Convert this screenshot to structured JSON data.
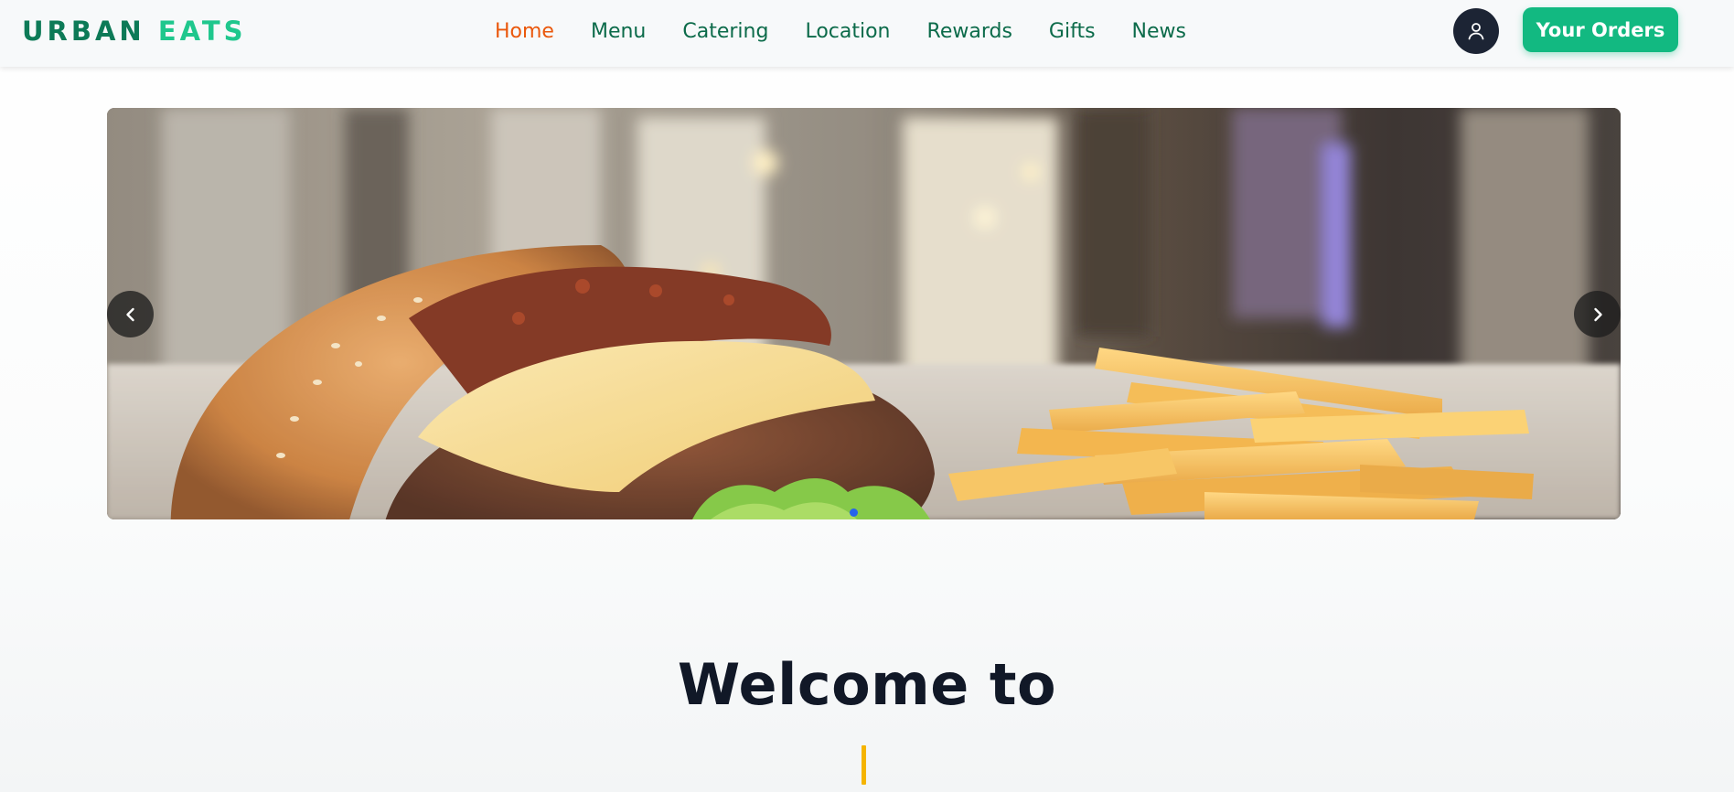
{
  "brand": {
    "word1": "URBAN",
    "word2": "EATS"
  },
  "nav": {
    "items": [
      {
        "label": "Home",
        "active": true
      },
      {
        "label": "Menu",
        "active": false
      },
      {
        "label": "Catering",
        "active": false
      },
      {
        "label": "Location",
        "active": false
      },
      {
        "label": "Rewards",
        "active": false
      },
      {
        "label": "Gifts",
        "active": false
      },
      {
        "label": "News",
        "active": false
      }
    ]
  },
  "header": {
    "account_icon": "user-icon",
    "orders_label": "Your Orders"
  },
  "carousel": {
    "image": "burger-and-fries-photo",
    "prev_icon": "chevron-left-icon",
    "next_icon": "chevron-right-icon",
    "dots": 1,
    "active_dot": 0
  },
  "welcome": {
    "heading": "Welcome to"
  },
  "colors": {
    "brand_dark": "#0d7a57",
    "brand_light": "#1fc78d",
    "nav_text": "#0c6b4a",
    "nav_active": "#ea580c",
    "orders_button": "#12b981",
    "account_button": "#1c2434",
    "heading": "#111827",
    "typing_cursor": "#f5b400"
  }
}
